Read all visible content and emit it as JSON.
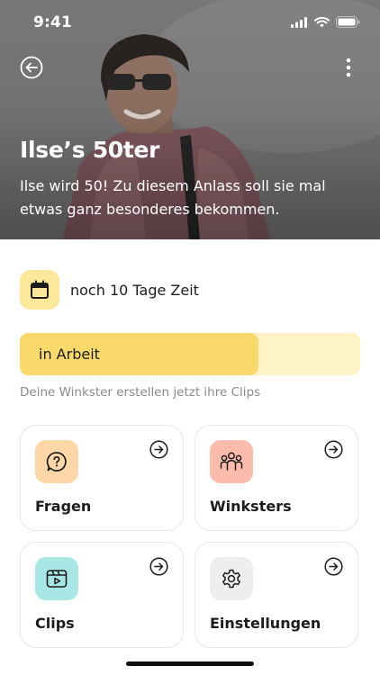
{
  "status_bar": {
    "time": "9:41"
  },
  "hero": {
    "title": "Ilse’s 50ter",
    "description": "Ilse wird 50! Zu diesem Anlass soll sie mal etwas ganz besonderes bekommen."
  },
  "deadline": {
    "icon": "calendar-icon",
    "text": "noch 10 Tage Zeit"
  },
  "progress": {
    "label": "in Arbeit",
    "fraction": 0.7,
    "hint": "Deine Winkster erstellen jetzt ihre Clips"
  },
  "cards": [
    {
      "label": "Fragen",
      "icon": "question-bubble-icon",
      "color": "#fdd7a8"
    },
    {
      "label": "Winksters",
      "icon": "people-group-icon",
      "color": "#fbbcab"
    },
    {
      "label": "Clips",
      "icon": "video-clip-icon",
      "color": "#a9e7e6"
    },
    {
      "label": "Einstellungen",
      "icon": "gear-icon",
      "color": "#eeeeee"
    }
  ],
  "colors": {
    "accent": "#f9d969",
    "track": "#fdf3c6",
    "calendar_tile": "#fde79a"
  }
}
